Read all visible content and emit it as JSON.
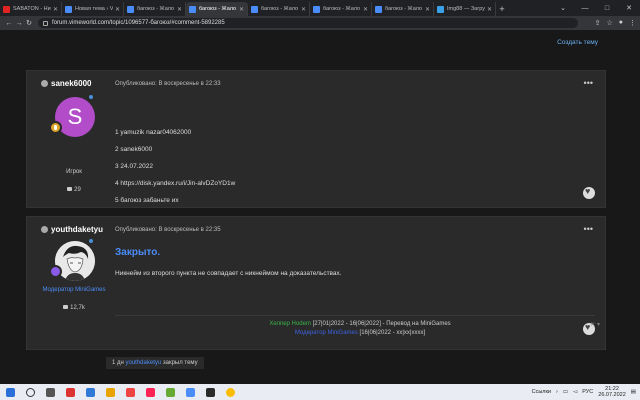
{
  "browser": {
    "tabs": [
      {
        "title": "SABATON - Ни",
        "color": "#e02424",
        "active": false
      },
      {
        "title": "Новая тема › V",
        "color": "#4b8df8",
        "active": false
      },
      {
        "title": "багоюз - Жало",
        "color": "#4b8df8",
        "active": false
      },
      {
        "title": "багоюз - Жало",
        "color": "#4b8df8",
        "active": true
      },
      {
        "title": "багоюз - Жало",
        "color": "#4b8df8",
        "active": false
      },
      {
        "title": "багоюз - Жало",
        "color": "#4b8df8",
        "active": false
      },
      {
        "title": "багоюз - Жало",
        "color": "#4b8df8",
        "active": false
      },
      {
        "title": "Img88 — Загру",
        "color": "#3aa0e8",
        "active": false
      }
    ],
    "url": "forum.vimeworld.com/topic/1096577-багоюз/#comment-5892285"
  },
  "topic": {
    "create_label": "Создать тему"
  },
  "posts": [
    {
      "author": "sanek6000",
      "posted": "Опубликовано: В воскресенье в 22:33",
      "avatar_letter": "S",
      "role": "Игрок",
      "count": "29",
      "lines": [
        "1 yamuzik  nazar04062000",
        "2 sanek6000",
        "3 24.07.2022",
        "4 https://disk.yandex.ru/i/Jin-alvDZoYD1w",
        "5 багоюз забаньте их"
      ]
    },
    {
      "author": "youthdaketyu",
      "posted": "Опубликовано: В воскресенье в 22:35",
      "role": "Модератор MiniGames",
      "count": "12,7k",
      "closed": "Закрыто.",
      "text": "Никнейм из второго пункта не совпадает с никнеймом на доказательствах.",
      "signature": {
        "line1_name": "Хелпер Hodem",
        "line1_rest": " [27|01|2022 - 16|06|2022] - Перевод на MiniGames",
        "line2_name": "Модератор MiniGames",
        "line2_rest": " [16|06|2022 - xx|xx|xxxx]"
      }
    }
  ],
  "event": {
    "time": "1 дн",
    "user": "youthdaketyu",
    "action": "закрыл тему"
  },
  "taskbar": {
    "links_label": "Ссылки",
    "lang": "РУС",
    "time": "21:22",
    "date": "26.07.2022"
  }
}
